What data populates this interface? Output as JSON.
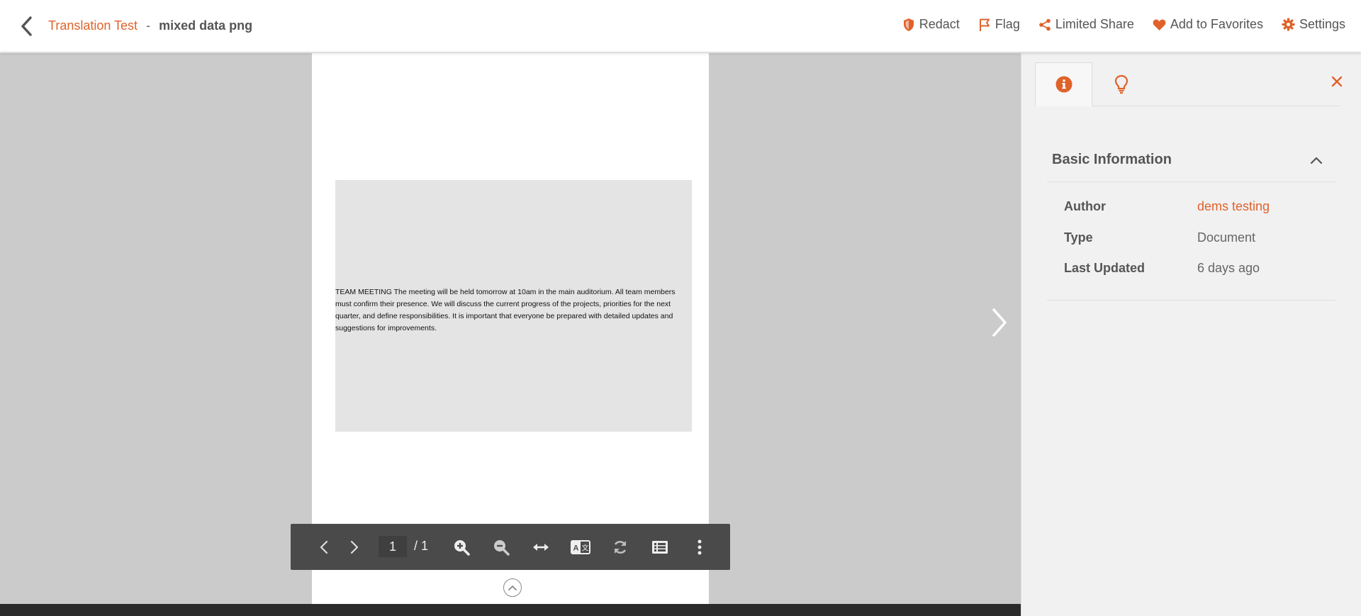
{
  "header": {
    "breadcrumb_parent": "Translation Test",
    "breadcrumb_separator": "-",
    "document_title": "mixed data png",
    "actions": [
      {
        "label": "Redact",
        "icon": "shield-icon"
      },
      {
        "label": "Flag",
        "icon": "flag-icon"
      },
      {
        "label": "Limited Share",
        "icon": "share-icon"
      },
      {
        "label": "Add to Favorites",
        "icon": "heart-icon"
      },
      {
        "label": "Settings",
        "icon": "gear-icon"
      }
    ]
  },
  "document": {
    "text": "TEAM MEETING The meeting will be held tomorrow at 10am in the main auditorium. All team members must confirm their presence. We will discuss the current progress of the projects, priorities for the next quarter, and define responsibilities. It is important that everyone be prepared with detailed updates and suggestions for improvements."
  },
  "toolbar": {
    "current_page": "1",
    "total_pages": "/ 1",
    "buttons": [
      "previous-page",
      "next-page",
      "zoom-in",
      "zoom-out",
      "fit-width",
      "translate",
      "rotate",
      "outline",
      "more"
    ]
  },
  "panel": {
    "tabs": [
      {
        "icon": "info-icon",
        "active": true
      },
      {
        "icon": "lightbulb-icon",
        "active": false
      }
    ],
    "section_title": "Basic Information",
    "fields": [
      {
        "label": "Author",
        "value": "dems testing",
        "link": true
      },
      {
        "label": "Type",
        "value": "Document",
        "link": false
      },
      {
        "label": "Last Updated",
        "value": "6 days ago",
        "link": false
      }
    ]
  },
  "colors": {
    "accent": "#e0622a",
    "viewer_bg": "#cbcbcb",
    "toolbar_bg": "#4a4a4a",
    "panel_bg": "#f1f1f2"
  }
}
